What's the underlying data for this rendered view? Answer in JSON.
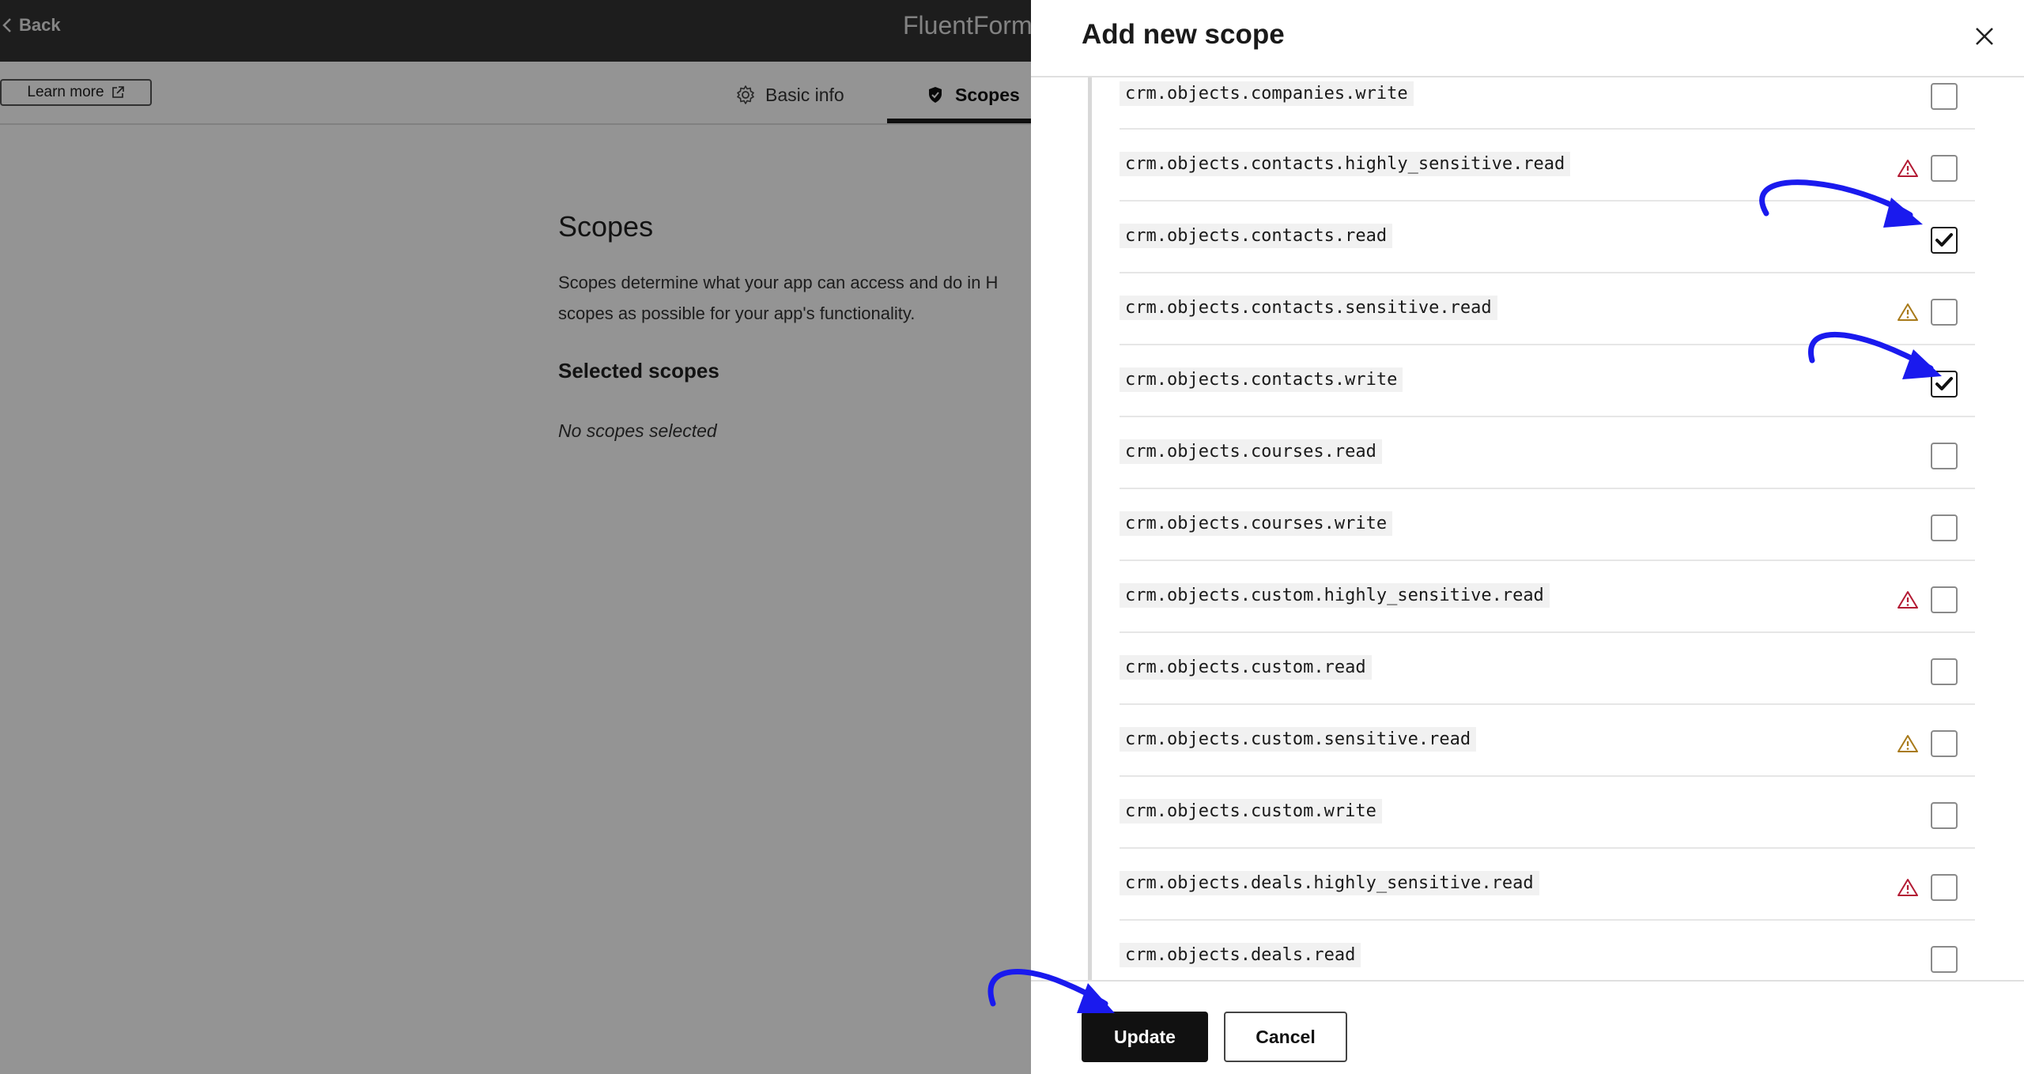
{
  "background": {
    "back_label": "Back",
    "app_title": "FluentForm",
    "learn_more_label": "Learn more",
    "tabs": [
      {
        "label": "Basic info",
        "icon": "gear-icon"
      },
      {
        "label": "Scopes",
        "icon": "shield-icon",
        "active": true
      }
    ],
    "scopes_heading": "Scopes",
    "scopes_description": "Scopes determine what your app can access and do in H scopes as possible for your app's functionality.",
    "selected_heading": "Selected scopes",
    "no_scopes_text": "No scopes selected"
  },
  "panel": {
    "title": "Add new scope",
    "scopes": [
      {
        "name": "crm.objects.companies.write",
        "warning": "none",
        "checked": false
      },
      {
        "name": "crm.objects.contacts.highly_sensitive.read",
        "warning": "high",
        "checked": false
      },
      {
        "name": "crm.objects.contacts.read",
        "warning": "none",
        "checked": true
      },
      {
        "name": "crm.objects.contacts.sensitive.read",
        "warning": "medium",
        "checked": false
      },
      {
        "name": "crm.objects.contacts.write",
        "warning": "none",
        "checked": true
      },
      {
        "name": "crm.objects.courses.read",
        "warning": "none",
        "checked": false
      },
      {
        "name": "crm.objects.courses.write",
        "warning": "none",
        "checked": false
      },
      {
        "name": "crm.objects.custom.highly_sensitive.read",
        "warning": "high",
        "checked": false
      },
      {
        "name": "crm.objects.custom.read",
        "warning": "none",
        "checked": false
      },
      {
        "name": "crm.objects.custom.sensitive.read",
        "warning": "medium",
        "checked": false
      },
      {
        "name": "crm.objects.custom.write",
        "warning": "none",
        "checked": false
      },
      {
        "name": "crm.objects.deals.highly_sensitive.read",
        "warning": "high",
        "checked": false
      },
      {
        "name": "crm.objects.deals.read",
        "warning": "none",
        "checked": false
      }
    ],
    "update_label": "Update",
    "cancel_label": "Cancel"
  },
  "colors": {
    "warning_high": "#b31b34",
    "warning_medium": "#a87a1a",
    "annotation_arrow": "#1a1aee",
    "primary_button": "#111111"
  }
}
